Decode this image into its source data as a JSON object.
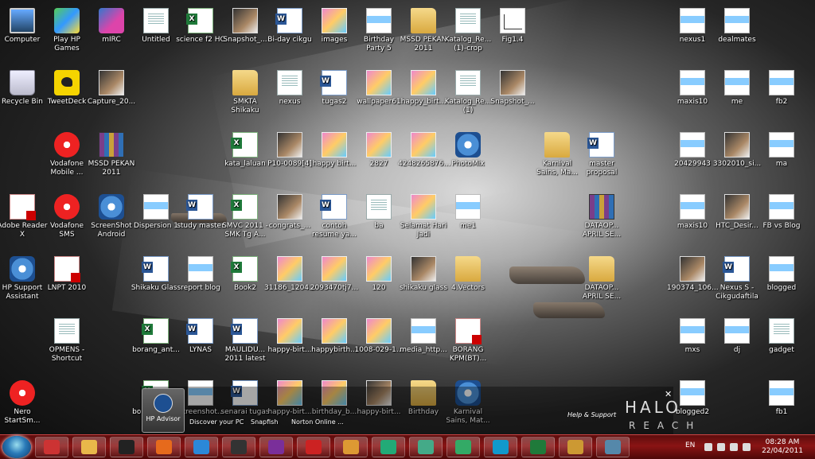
{
  "desktop": {
    "icons": [
      {
        "label": "Computer",
        "type": "comp"
      },
      {
        "label": "Play HP Games",
        "type": "games"
      },
      {
        "label": "mIRC",
        "type": "mirc"
      },
      {
        "label": "Untitled",
        "type": "doc"
      },
      {
        "label": "science f2 HC",
        "type": "excel"
      },
      {
        "label": "Snapshot_...",
        "type": "photo"
      },
      {
        "label": "Bi-day cikgu",
        "type": "word"
      },
      {
        "label": "images",
        "type": "img"
      },
      {
        "label": "Birthday Party 5",
        "type": "thumb"
      },
      {
        "label": "MSSD PEKAN 2011",
        "type": "folder"
      },
      {
        "label": "Katalog_Re... (1)-crop",
        "type": "doc"
      },
      {
        "label": "Fig1.4",
        "type": "chart"
      },
      {
        "label": "nexus1",
        "type": "thumb"
      },
      {
        "label": "dealmates",
        "type": "thumb"
      },
      {
        "label": "Recycle Bin",
        "type": "bin"
      },
      {
        "label": "TweetDeck",
        "type": "bird"
      },
      {
        "label": "Capture_20...",
        "type": "photo"
      },
      {
        "label": "SMKTA Shikaku",
        "type": "folder"
      },
      {
        "label": "nexus",
        "type": "doc"
      },
      {
        "label": "tugas2",
        "type": "word"
      },
      {
        "label": "wallpaper61",
        "type": "img"
      },
      {
        "label": "happy_birt...",
        "type": "img"
      },
      {
        "label": "Katalog_Re... (1)",
        "type": "doc"
      },
      {
        "label": "Snapshot_...",
        "type": "photo"
      },
      {
        "label": "maxis10",
        "type": "thumb"
      },
      {
        "label": "me",
        "type": "thumb"
      },
      {
        "label": "fb2",
        "type": "thumb"
      },
      {
        "label": "Vodafone Mobile ...",
        "type": "red"
      },
      {
        "label": "MSSD PEKAN 2011",
        "type": "rar"
      },
      {
        "label": "kata_laluan",
        "type": "excel"
      },
      {
        "label": "P10-0089[4]",
        "type": "photo"
      },
      {
        "label": "happy birt...",
        "type": "img"
      },
      {
        "label": "2827",
        "type": "img"
      },
      {
        "label": "4248265876...",
        "type": "img"
      },
      {
        "label": "PhotoMix",
        "type": "app"
      },
      {
        "label": "Karnival Sains, Ma...",
        "type": "folder"
      },
      {
        "label": "master proposal",
        "type": "word"
      },
      {
        "label": "20429943",
        "type": "thumb"
      },
      {
        "label": "3302010_si...",
        "type": "photo"
      },
      {
        "label": "ma",
        "type": "thumb"
      },
      {
        "label": "Adobe Reader X",
        "type": "pdf"
      },
      {
        "label": "Vodafone SMS",
        "type": "red"
      },
      {
        "label": "ScreenShot Android",
        "type": "app"
      },
      {
        "label": "Dispersion 1",
        "type": "thumb"
      },
      {
        "label": "study master",
        "type": "word"
      },
      {
        "label": "SMVC 2011 - SMK Tg A...",
        "type": "excel"
      },
      {
        "label": "congrats_...",
        "type": "photo"
      },
      {
        "label": "contoh resume ya...",
        "type": "word"
      },
      {
        "label": "ba",
        "type": "doc"
      },
      {
        "label": "Selamat Hari Jadi",
        "type": "img"
      },
      {
        "label": "me1",
        "type": "thumb"
      },
      {
        "label": "DATAOP... APRIL SE...",
        "type": "rar"
      },
      {
        "label": "maxis10",
        "type": "thumb"
      },
      {
        "label": "HTC_Desir...",
        "type": "photo"
      },
      {
        "label": "FB vs Blog",
        "type": "thumb"
      },
      {
        "label": "HP Support Assistant",
        "type": "app"
      },
      {
        "label": "LNPT 2010",
        "type": "pdf"
      },
      {
        "label": "Shikaku Glass",
        "type": "word"
      },
      {
        "label": "report blog",
        "type": "thumb"
      },
      {
        "label": "Book2",
        "type": "excel"
      },
      {
        "label": "31186_1204...",
        "type": "img"
      },
      {
        "label": "2093470tj7...",
        "type": "img"
      },
      {
        "label": "120",
        "type": "img"
      },
      {
        "label": "shikaku glass",
        "type": "photo"
      },
      {
        "label": "4.Vectors",
        "type": "folder"
      },
      {
        "label": "DATAOP... APRIL SE...",
        "type": "folder"
      },
      {
        "label": "190374_106...",
        "type": "photo"
      },
      {
        "label": "Nexus S - Cikgudaftila",
        "type": "word"
      },
      {
        "label": "blogged",
        "type": "thumb"
      },
      {
        "label": "OPMENS - Shortcut",
        "type": "doc"
      },
      {
        "label": "borang_ant...",
        "type": "excel"
      },
      {
        "label": "LYNAS",
        "type": "word"
      },
      {
        "label": "MAULIDU... 2011 latest",
        "type": "word"
      },
      {
        "label": "happy-birt...",
        "type": "img"
      },
      {
        "label": "happybirth...",
        "type": "img"
      },
      {
        "label": "1008-029-1...",
        "type": "img"
      },
      {
        "label": "media_http...",
        "type": "thumb"
      },
      {
        "label": "BORANG KPM(BT)...",
        "type": "pdf"
      },
      {
        "label": "mxs",
        "type": "thumb"
      },
      {
        "label": "dj",
        "type": "thumb"
      },
      {
        "label": "gadget",
        "type": "doc"
      },
      {
        "label": "Nero StartSm...",
        "type": "red"
      },
      {
        "label": "borang_ant...",
        "type": "excel"
      },
      {
        "label": "Screenshot...",
        "type": "thumb"
      },
      {
        "label": "senarai tugas",
        "type": "word"
      },
      {
        "label": "happy-birt...",
        "type": "img"
      },
      {
        "label": "birthday_b...",
        "type": "img"
      },
      {
        "label": "happy-birt...",
        "type": "photo"
      },
      {
        "label": "Birthday",
        "type": "folder"
      },
      {
        "label": "Karnival Sains, Mat...",
        "type": "app"
      },
      {
        "label": "blogged2",
        "type": "thumb"
      },
      {
        "label": "fb1",
        "type": "thumb"
      }
    ]
  },
  "gadgets": {
    "hp_advisor": "HP Advisor",
    "discover": "Discover your PC",
    "snapfish": "Snapfish",
    "norton": "Norton Online ...",
    "help": "Help & Support",
    "halo_title": "HALO",
    "halo_sub": "REACH"
  },
  "taskbar": {
    "items": [
      "media-player",
      "explorer",
      "winamp",
      "firefox",
      "ie",
      "hp",
      "yahoo",
      "acrobat",
      "paint",
      "msn",
      "chrome",
      "people",
      "skype",
      "excel",
      "security",
      "gallery"
    ],
    "lang": "EN",
    "time": "08:28 AM",
    "date": "22/04/2011"
  },
  "colors": {
    "taskbar": "#8a1414",
    "accent": "#2a7ab8"
  }
}
